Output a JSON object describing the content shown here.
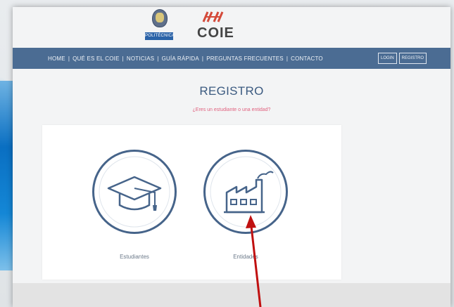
{
  "header": {
    "university_label": "POLITÉCNICA",
    "brand": "COIE"
  },
  "nav": {
    "links": [
      "HOME",
      "QUÉ ES EL COIE",
      "NOTICIAS",
      "GUÍA RÁPIDA",
      "PREGUNTAS FRECUENTES",
      "CONTACTO"
    ],
    "separator": "|",
    "login_label": "LOGIN",
    "register_label": "REGISTRO"
  },
  "main": {
    "title": "REGISTRO",
    "question": "¿Eres un estudiante o una entidad?",
    "options": [
      {
        "label": "Estudiantes",
        "icon": "graduation-cap-icon"
      },
      {
        "label": "Entidades",
        "icon": "factory-icon"
      }
    ]
  },
  "colors": {
    "navbar": "#4b6c93",
    "accent_pink": "#e0607e",
    "icon_blue": "#46648a",
    "arrow_red": "#c01010"
  }
}
